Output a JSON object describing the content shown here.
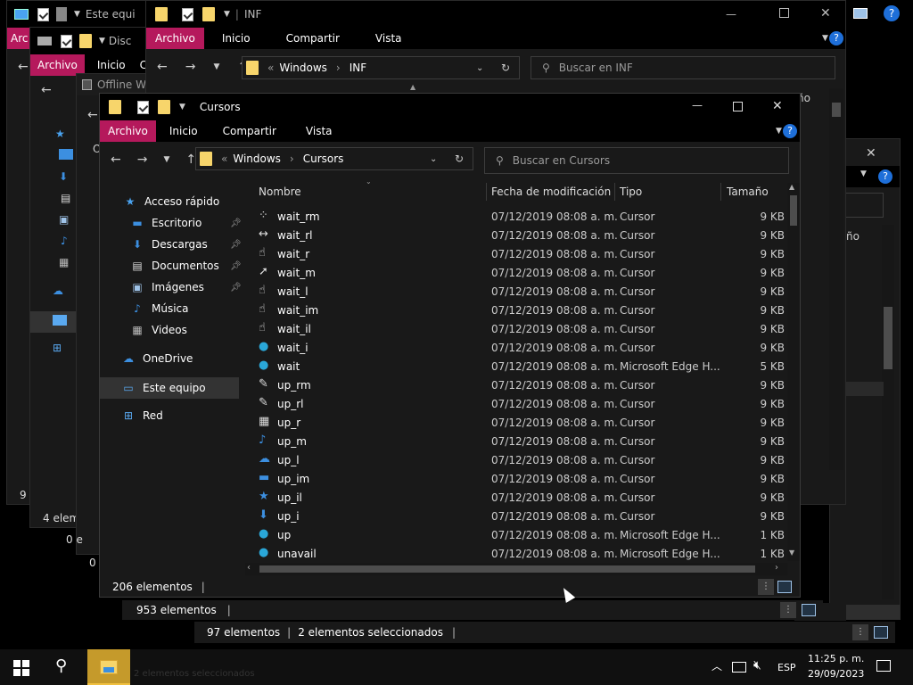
{
  "win_back1": {
    "title": "Este equi",
    "ribbon": [
      "Arc"
    ],
    "status": "9 e"
  },
  "win_back2": {
    "title": "Disc",
    "ribbon": [
      "Archivo",
      "Inicio",
      "C"
    ],
    "status": "4 elem",
    "status2": "0 e"
  },
  "win_offline": {
    "title": "Offline W",
    "status": "0 e",
    "letter": "O"
  },
  "win_inf": {
    "title": "INF",
    "ribbon": [
      "Archivo",
      "Inicio",
      "Compartir",
      "Vista"
    ],
    "breadcrumb": [
      "Windows",
      "INF"
    ],
    "search_placeholder": "Buscar en INF",
    "status": "953 elementos",
    "partial_col": "ño"
  },
  "win_side": {
    "partial_col": "ño"
  },
  "win_bottom": {
    "status_count": "97 elementos",
    "status_sel": "2 elementos seleccionados"
  },
  "cursors": {
    "title": "Cursors",
    "ribbon": [
      "Archivo",
      "Inicio",
      "Compartir",
      "Vista"
    ],
    "breadcrumb": [
      "Windows",
      "Cursors"
    ],
    "search_placeholder": "Buscar en Cursors",
    "sidebar": [
      {
        "label": "Acceso rápido",
        "icon": "star-icon",
        "glyph": "★",
        "color": "#4aa3f0",
        "pinned": false
      },
      {
        "label": "Escritorio",
        "icon": "desktop-icon",
        "glyph": "▬",
        "color": "#3c8fe0",
        "pinned": true
      },
      {
        "label": "Descargas",
        "icon": "download-icon",
        "glyph": "⬇",
        "color": "#3c8fe0",
        "pinned": true
      },
      {
        "label": "Documentos",
        "icon": "document-icon",
        "glyph": "▤",
        "color": "#dddddd",
        "pinned": true
      },
      {
        "label": "Imágenes",
        "icon": "image-icon",
        "glyph": "▣",
        "color": "#9fc3e8",
        "pinned": true
      },
      {
        "label": "Música",
        "icon": "music-icon",
        "glyph": "♪",
        "color": "#3c8fe0",
        "pinned": false
      },
      {
        "label": "Videos",
        "icon": "video-icon",
        "glyph": "▦",
        "color": "#bbbbbb",
        "pinned": false
      },
      {
        "label": "OneDrive",
        "icon": "cloud-icon",
        "glyph": "☁",
        "color": "#3c8fe0",
        "pinned": false
      },
      {
        "label": "Este equipo",
        "icon": "computer-icon",
        "glyph": "▭",
        "color": "#5aa9f0",
        "pinned": false
      },
      {
        "label": "Red",
        "icon": "network-icon",
        "glyph": "⊞",
        "color": "#5aa9f0",
        "pinned": false
      }
    ],
    "columns": [
      "Nombre",
      "Fecha de modificación",
      "Tipo",
      "Tamaño"
    ],
    "files": [
      {
        "name": "wait_rm",
        "date": "07/12/2019 08:08 a. m.",
        "type": "Cursor",
        "size": "9 KB",
        "icon": "cursor-move-icon",
        "glyph": "⁘"
      },
      {
        "name": "wait_rl",
        "date": "07/12/2019 08:08 a. m.",
        "type": "Cursor",
        "size": "9 KB",
        "icon": "cursor-resize-icon",
        "glyph": "↔"
      },
      {
        "name": "wait_r",
        "date": "07/12/2019 08:08 a. m.",
        "type": "Cursor",
        "size": "9 KB",
        "icon": "cursor-hand-icon",
        "glyph": "☝"
      },
      {
        "name": "wait_m",
        "date": "07/12/2019 08:08 a. m.",
        "type": "Cursor",
        "size": "9 KB",
        "icon": "cursor-help-icon",
        "glyph": "➚"
      },
      {
        "name": "wait_l",
        "date": "07/12/2019 08:08 a. m.",
        "type": "Cursor",
        "size": "9 KB",
        "icon": "cursor-hand-icon",
        "glyph": "☝"
      },
      {
        "name": "wait_im",
        "date": "07/12/2019 08:08 a. m.",
        "type": "Cursor",
        "size": "9 KB",
        "icon": "cursor-hand-icon",
        "glyph": "☝"
      },
      {
        "name": "wait_il",
        "date": "07/12/2019 08:08 a. m.",
        "type": "Cursor",
        "size": "9 KB",
        "icon": "cursor-hand-icon",
        "glyph": "☝"
      },
      {
        "name": "wait_i",
        "date": "07/12/2019 08:08 a. m.",
        "type": "Cursor",
        "size": "9 KB",
        "icon": "edge-icon",
        "glyph": "●"
      },
      {
        "name": "wait",
        "date": "07/12/2019 08:08 a. m.",
        "type": "Microsoft Edge H...",
        "size": "5 KB",
        "icon": "edge-icon",
        "glyph": "●"
      },
      {
        "name": "up_rm",
        "date": "07/12/2019 08:08 a. m.",
        "type": "Cursor",
        "size": "9 KB",
        "icon": "cursor-pen-icon",
        "glyph": "✎"
      },
      {
        "name": "up_rl",
        "date": "07/12/2019 08:08 a. m.",
        "type": "Cursor",
        "size": "9 KB",
        "icon": "cursor-pen-icon",
        "glyph": "✎"
      },
      {
        "name": "up_r",
        "date": "07/12/2019 08:08 a. m.",
        "type": "Cursor",
        "size": "9 KB",
        "icon": "video-icon",
        "glyph": "▦"
      },
      {
        "name": "up_m",
        "date": "07/12/2019 08:08 a. m.",
        "type": "Cursor",
        "size": "9 KB",
        "icon": "music-icon",
        "glyph": "♪"
      },
      {
        "name": "up_l",
        "date": "07/12/2019 08:08 a. m.",
        "type": "Cursor",
        "size": "9 KB",
        "icon": "cloud-icon",
        "glyph": "☁"
      },
      {
        "name": "up_im",
        "date": "07/12/2019 08:08 a. m.",
        "type": "Cursor",
        "size": "9 KB",
        "icon": "desktop-icon",
        "glyph": "▬"
      },
      {
        "name": "up_il",
        "date": "07/12/2019 08:08 a. m.",
        "type": "Cursor",
        "size": "9 KB",
        "icon": "star-icon",
        "glyph": "★"
      },
      {
        "name": "up_i",
        "date": "07/12/2019 08:08 a. m.",
        "type": "Cursor",
        "size": "9 KB",
        "icon": "download-icon",
        "glyph": "⬇"
      },
      {
        "name": "up",
        "date": "07/12/2019 08:08 a. m.",
        "type": "Microsoft Edge H...",
        "size": "1 KB",
        "icon": "edge-icon",
        "glyph": "●"
      },
      {
        "name": "unavail",
        "date": "07/12/2019 08:08 a. m.",
        "type": "Microsoft Edge H...",
        "size": "1 KB",
        "icon": "edge-icon",
        "glyph": "●"
      }
    ],
    "status": "206 elementos"
  },
  "taskbar": {
    "lang": "ESP",
    "time": "11:25 p. m.",
    "date": "29/09/2023",
    "ghost_text": "2 elementos seleccionados"
  },
  "colors": {
    "accent": "#b5195c",
    "folder": "#f7d56b",
    "link": "#3c8fe0"
  }
}
